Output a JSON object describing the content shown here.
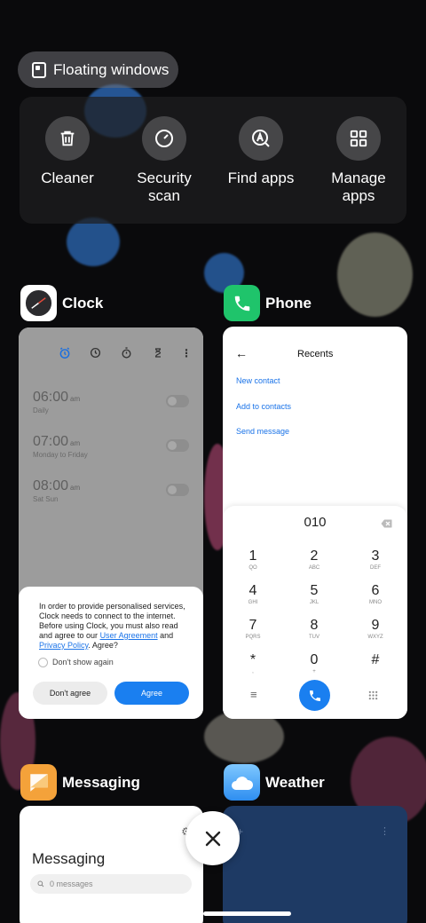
{
  "floating_windows": {
    "label": "Floating windows"
  },
  "tools": [
    {
      "label": "Cleaner",
      "icon": "trash-icon"
    },
    {
      "label": "Security scan",
      "icon": "speedometer-icon"
    },
    {
      "label": "Find apps",
      "icon": "find-apps-icon"
    },
    {
      "label": "Manage apps",
      "icon": "grid-icon"
    }
  ],
  "apps": {
    "clock": {
      "name": "Clock",
      "alarms": [
        {
          "time": "06:00",
          "ampm": "am",
          "repeat": "Daily"
        },
        {
          "time": "07:00",
          "ampm": "am",
          "repeat": "Monday to Friday"
        },
        {
          "time": "08:00",
          "ampm": "am",
          "repeat": "Sat Sun"
        }
      ],
      "dialog": {
        "text_1": "In order to provide personalised services, Clock needs to connect to the internet. Before using Clock, you must also read and agree to our ",
        "link_1": "User Agreement",
        "text_2": " and ",
        "link_2": "Privacy Policy",
        "text_3": ". Agree?",
        "checkbox": "Don't show again",
        "decline": "Don't agree",
        "accept": "Agree"
      }
    },
    "phone": {
      "name": "Phone",
      "title": "Recents",
      "links": [
        "New contact",
        "Add to contacts",
        "Send message"
      ],
      "dialed": "010",
      "keys": [
        {
          "d": "1",
          "l": "QO"
        },
        {
          "d": "2",
          "l": "ABC"
        },
        {
          "d": "3",
          "l": "DEF"
        },
        {
          "d": "4",
          "l": "GHI"
        },
        {
          "d": "5",
          "l": "JKL"
        },
        {
          "d": "6",
          "l": "MNO"
        },
        {
          "d": "7",
          "l": "PQRS"
        },
        {
          "d": "8",
          "l": "TUV"
        },
        {
          "d": "9",
          "l": "WXYZ"
        },
        {
          "d": "*",
          "l": ","
        },
        {
          "d": "0",
          "l": "+"
        },
        {
          "d": "#",
          "l": ""
        }
      ]
    },
    "messaging": {
      "name": "Messaging",
      "title": "Messaging",
      "search_placeholder": "0 messages"
    },
    "weather": {
      "name": "Weather"
    }
  },
  "colors": {
    "accent": "#1a7ff0",
    "phone_icon": "#1fc46b",
    "messaging_icon": "#f4a23a",
    "weather_icon": "#3ba8f5"
  }
}
